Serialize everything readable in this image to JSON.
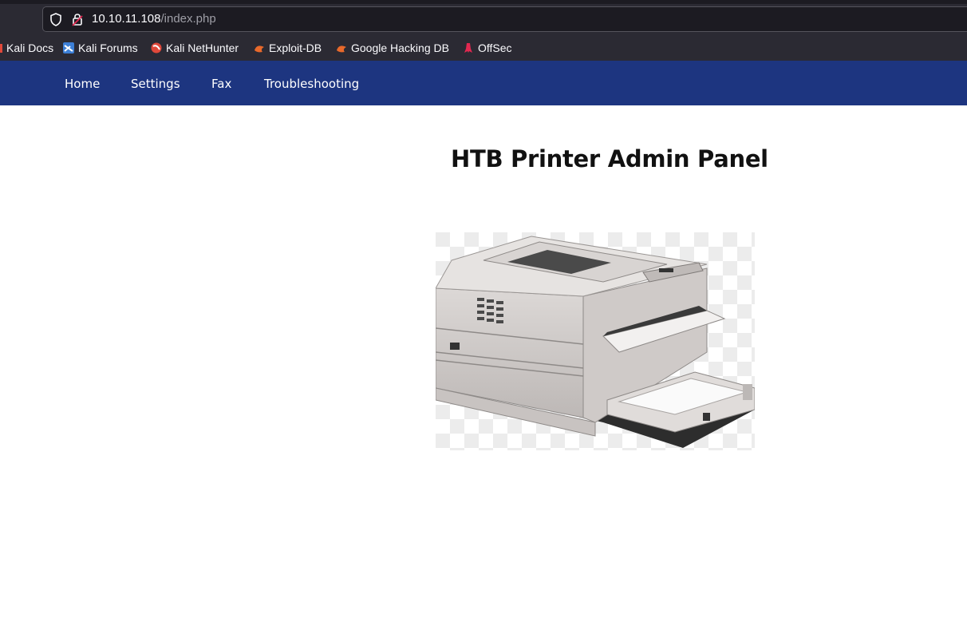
{
  "browser": {
    "url_host": "10.10.11.108",
    "url_path": "/index.php",
    "bookmarks": [
      {
        "label": "Kali Docs",
        "icon": "kali-icon"
      },
      {
        "label": "Kali Forums",
        "icon": "kali-forums-icon"
      },
      {
        "label": "Kali NetHunter",
        "icon": "nethunter-icon"
      },
      {
        "label": "Exploit-DB",
        "icon": "exploit-db-icon"
      },
      {
        "label": "Google Hacking DB",
        "icon": "ghdb-icon"
      },
      {
        "label": "OffSec",
        "icon": "offsec-icon"
      }
    ]
  },
  "nav": {
    "items": [
      "Home",
      "Settings",
      "Fax",
      "Troubleshooting"
    ]
  },
  "main": {
    "title": "HTB Printer Admin Panel"
  },
  "colors": {
    "chrome_bg": "#2b2a33",
    "nav_bg": "#1d3580",
    "lock_red": "#e22850"
  }
}
